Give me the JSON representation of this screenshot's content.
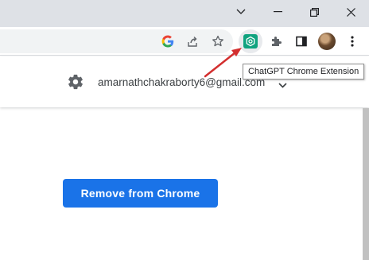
{
  "window_controls": {
    "icons": [
      "chevron-down-icon",
      "minimize-icon",
      "restore-icon",
      "close-icon"
    ]
  },
  "toolbar": {
    "icons": [
      "google-icon",
      "share-icon",
      "bookmark-star-icon",
      "chatgpt-extension-icon",
      "extensions-puzzle-icon",
      "side-panel-icon",
      "profile-avatar",
      "more-menu-icon"
    ]
  },
  "tooltip": {
    "text": "ChatGPT Chrome Extension"
  },
  "header": {
    "settings_icon": "gear-icon",
    "account_email": "amarnathchakraborty6@gmail.com"
  },
  "main": {
    "remove_button_label": "Remove from Chrome"
  },
  "colors": {
    "accent": "#1a73e8",
    "annotation_arrow": "#d32f2f",
    "extension_icon": "#10a37f"
  }
}
